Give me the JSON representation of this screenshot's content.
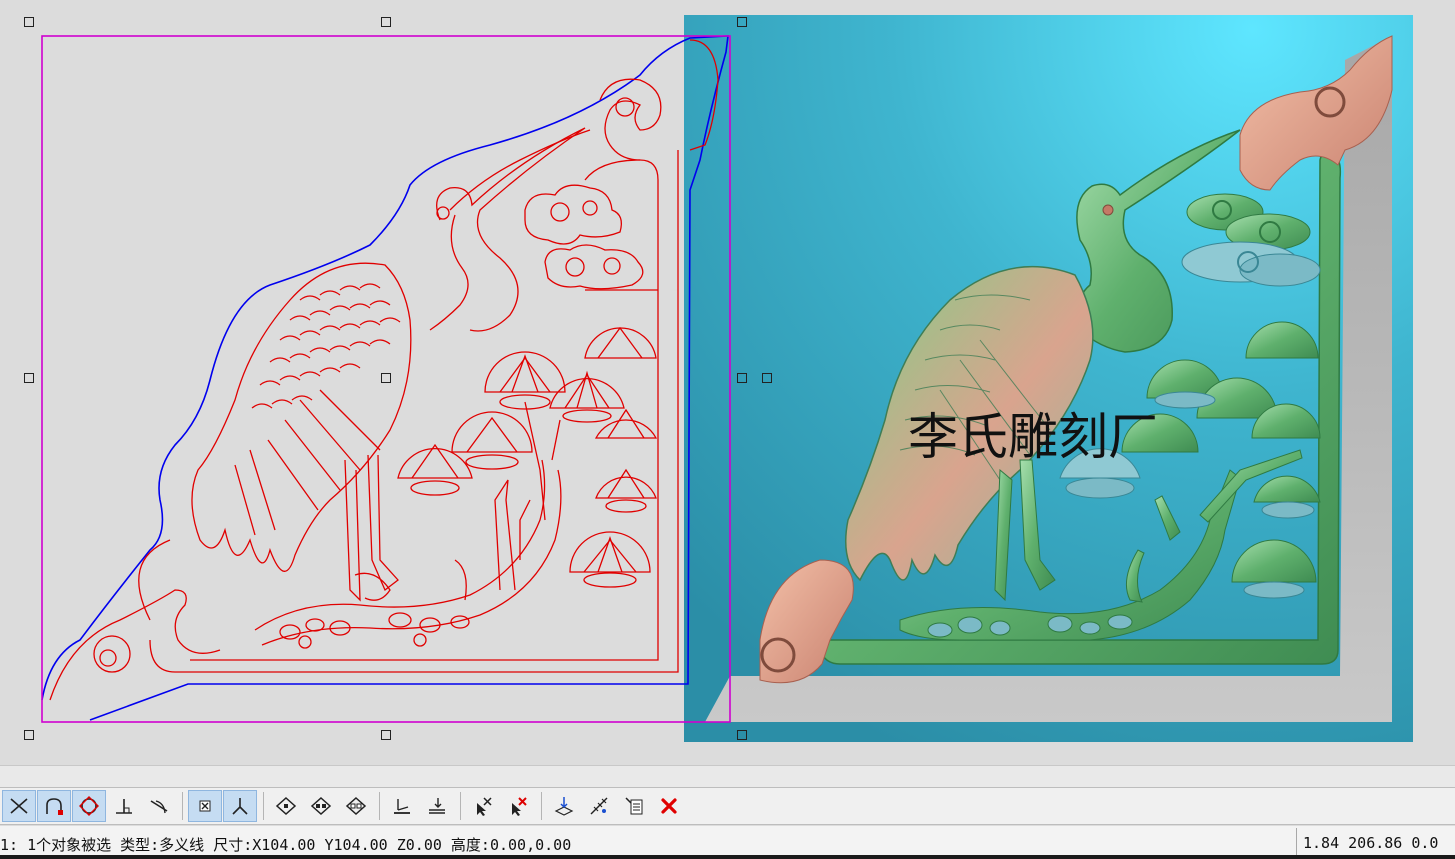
{
  "watermark": "李氏雕刻厂",
  "status": {
    "left": "1: 1个对象被选 类型:多义线 尺寸:X104.00 Y104.00 Z0.00 高度:0.00,0.00",
    "right": "1.84 206.86 0.0"
  },
  "toolbar": {
    "tools": [
      {
        "name": "intersection-snap-icon",
        "active": true
      },
      {
        "name": "arc-snap-icon",
        "active": true
      },
      {
        "name": "center-snap-icon",
        "active": true
      },
      {
        "name": "perpendicular-snap-icon",
        "active": false
      },
      {
        "name": "tangent-snap-icon",
        "active": false
      },
      {
        "name": "node-snap-icon",
        "active": true
      },
      {
        "name": "axis-snap-icon",
        "active": true
      },
      {
        "name": "diamond-node-icon",
        "active": false
      },
      {
        "name": "diamond-nodes-add-icon",
        "active": false
      },
      {
        "name": "diamond-nodes-remove-icon",
        "active": false
      },
      {
        "name": "align-bottom-icon",
        "active": false
      },
      {
        "name": "align-bottom-arrow-icon",
        "active": false
      },
      {
        "name": "select-arrow-cross-icon",
        "active": false
      },
      {
        "name": "select-arrow-delete-icon",
        "active": false
      },
      {
        "name": "move-down-icon",
        "active": false
      },
      {
        "name": "measure-tool-icon",
        "active": false
      },
      {
        "name": "list-edit-icon",
        "active": false
      },
      {
        "name": "delete-icon",
        "active": false
      }
    ]
  },
  "colors": {
    "canvas_bg": "#dcdcdc",
    "vector_red": "#e00000",
    "boundary_blue": "#0000ee",
    "selection_magenta": "#d000d0",
    "relief_bg": "#3fb3cc",
    "relief_green": "#6fbf7a",
    "relief_salmon": "#e0a08a"
  }
}
